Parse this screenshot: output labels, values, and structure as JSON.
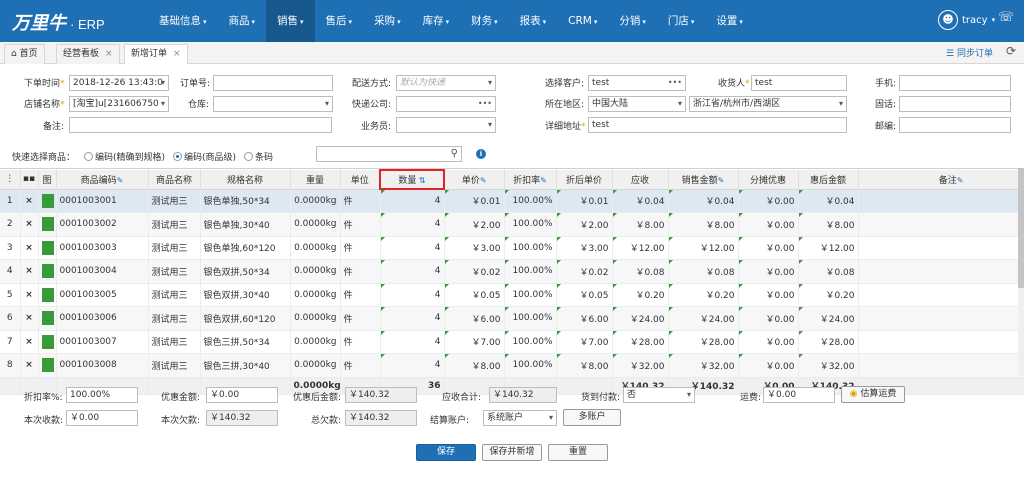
{
  "app": {
    "logo": "万里牛",
    "logo_suffix": "· ERP",
    "user": "tracy"
  },
  "nav": [
    "基础信息",
    "商品",
    "销售",
    "售后",
    "采购",
    "库存",
    "财务",
    "报表",
    "CRM",
    "分销",
    "门店",
    "设置"
  ],
  "nav_has_caret": [
    true,
    true,
    true,
    true,
    true,
    true,
    true,
    true,
    true,
    true,
    true,
    true
  ],
  "nav_active": 2,
  "tabs": {
    "home": "首页",
    "dashboard": "经营看板",
    "new_order": "新增订单",
    "sync": "同步订单"
  },
  "form": {
    "order_time_label": "下单时间",
    "order_time_value": "2018-12-26 13:43:0",
    "shop_label": "店铺名称",
    "shop_value": "[淘宝]u[231606750",
    "remark_label": "备注:",
    "order_no_label": "订单号:",
    "warehouse_label": "仓库:",
    "ship_method_label": "配送方式:",
    "ship_method_placeholder": "默认为快递",
    "express_label": "快递公司:",
    "salesman_label": "业务员:",
    "customer_label": "选择客户:",
    "customer_value": "test",
    "region_label": "所在地区:",
    "region_country": "中国大陆",
    "region_value": "浙江省/杭州市/西湖区",
    "address_label": "详细地址",
    "address_value": "test",
    "receiver_label": "收货人",
    "receiver_value": "test",
    "mobile_label": "手机:",
    "phone_label": "固话:",
    "email_label": "邮编:"
  },
  "quick": {
    "label": "快速选择商品：",
    "opt1": "编码(精确到规格)",
    "opt2": "编码(商品级)",
    "opt3": "条码"
  },
  "grid": {
    "headers": [
      "商品编码",
      "商品名称",
      "规格名称",
      "重量",
      "单位",
      "数量",
      "单价",
      "折扣率",
      "折后单价",
      "应收",
      "销售金额",
      "分摊优惠",
      "惠后金额",
      "备注"
    ],
    "rows": [
      {
        "idx": "1",
        "code": "0001003001",
        "name": "测试用三",
        "spec": "银色单独,50*34",
        "weight": "0.0000kg",
        "unit": "件",
        "qty": "4",
        "price": "￥0.01",
        "disc": "100.00%",
        "dprice": "￥0.01",
        "recv": "￥0.04",
        "amount": "￥0.04",
        "share": "￥0.00",
        "after": "￥0.04"
      },
      {
        "idx": "2",
        "code": "0001003002",
        "name": "测试用三",
        "spec": "银色单独,30*40",
        "weight": "0.0000kg",
        "unit": "件",
        "qty": "4",
        "price": "￥2.00",
        "disc": "100.00%",
        "dprice": "￥2.00",
        "recv": "￥8.00",
        "amount": "￥8.00",
        "share": "￥0.00",
        "after": "￥8.00"
      },
      {
        "idx": "3",
        "code": "0001003003",
        "name": "测试用三",
        "spec": "银色单独,60*120",
        "weight": "0.0000kg",
        "unit": "件",
        "qty": "4",
        "price": "￥3.00",
        "disc": "100.00%",
        "dprice": "￥3.00",
        "recv": "￥12.00",
        "amount": "￥12.00",
        "share": "￥0.00",
        "after": "￥12.00"
      },
      {
        "idx": "4",
        "code": "0001003004",
        "name": "测试用三",
        "spec": "银色双拼,50*34",
        "weight": "0.0000kg",
        "unit": "件",
        "qty": "4",
        "price": "￥0.02",
        "disc": "100.00%",
        "dprice": "￥0.02",
        "recv": "￥0.08",
        "amount": "￥0.08",
        "share": "￥0.00",
        "after": "￥0.08"
      },
      {
        "idx": "5",
        "code": "0001003005",
        "name": "测试用三",
        "spec": "银色双拼,30*40",
        "weight": "0.0000kg",
        "unit": "件",
        "qty": "4",
        "price": "￥0.05",
        "disc": "100.00%",
        "dprice": "￥0.05",
        "recv": "￥0.20",
        "amount": "￥0.20",
        "share": "￥0.00",
        "after": "￥0.20"
      },
      {
        "idx": "6",
        "code": "0001003006",
        "name": "测试用三",
        "spec": "银色双拼,60*120",
        "weight": "0.0000kg",
        "unit": "件",
        "qty": "4",
        "price": "￥6.00",
        "disc": "100.00%",
        "dprice": "￥6.00",
        "recv": "￥24.00",
        "amount": "￥24.00",
        "share": "￥0.00",
        "after": "￥24.00"
      },
      {
        "idx": "7",
        "code": "0001003007",
        "name": "测试用三",
        "spec": "银色三拼,50*34",
        "weight": "0.0000kg",
        "unit": "件",
        "qty": "4",
        "price": "￥7.00",
        "disc": "100.00%",
        "dprice": "￥7.00",
        "recv": "￥28.00",
        "amount": "￥28.00",
        "share": "￥0.00",
        "after": "￥28.00"
      },
      {
        "idx": "8",
        "code": "0001003008",
        "name": "测试用三",
        "spec": "银色三拼,30*40",
        "weight": "0.0000kg",
        "unit": "件",
        "qty": "4",
        "price": "￥8.00",
        "disc": "100.00%",
        "dprice": "￥8.00",
        "recv": "￥32.00",
        "amount": "￥32.00",
        "share": "￥0.00",
        "after": "￥32.00"
      }
    ],
    "totals": {
      "weight": "0.0000kg",
      "qty": "36",
      "recv": "￥140.32",
      "amount": "￥140.32",
      "share": "￥0.00",
      "after": "￥140.32"
    }
  },
  "footer": {
    "disc_label": "折扣率%:",
    "disc_value": "100.00%",
    "promo_label": "优惠金额:",
    "promo_value": "￥0.00",
    "after_label": "优惠后金额:",
    "after_value": "￥140.32",
    "recv_total_label": "应收合计:",
    "recv_total_value": "￥140.32",
    "cod_label": "货到付款:",
    "cod_value": "否",
    "freight_label": "运费:",
    "freight_value": "￥0.00",
    "estimate_btn": "估算运费",
    "paid_label": "本次收款:",
    "paid_value": "￥0.00",
    "owe_label": "本次欠款:",
    "owe_value": "￥140.32",
    "total_owe_label": "总欠款:",
    "total_owe_value": "￥140.32",
    "account_label": "结算账户:",
    "account_value": "系统账户",
    "multi_btn": "多账户",
    "save": "保存",
    "save_new": "保存并新增",
    "reset": "重置"
  }
}
